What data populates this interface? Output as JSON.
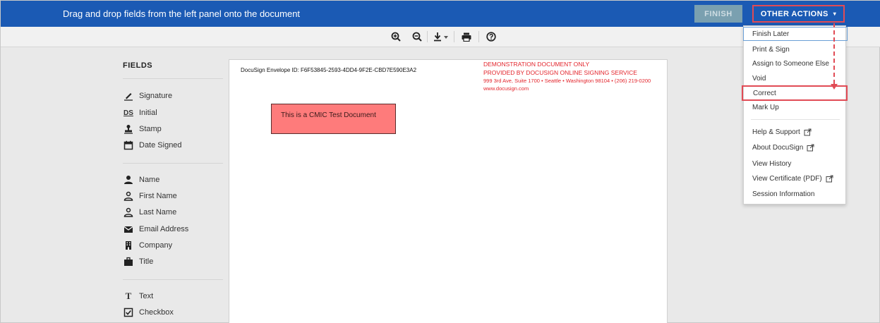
{
  "topbar": {
    "instruction": "Drag and drop fields from the left panel onto the document",
    "finish_label": "FINISH",
    "other_actions_label": "OTHER ACTIONS",
    "other_actions_caret": "▾"
  },
  "toolbar": {
    "icons": [
      "zoom-in-icon",
      "zoom-out-icon",
      "download-icon",
      "print-icon",
      "help-icon"
    ]
  },
  "fields": {
    "title": "FIELDS",
    "group1": [
      {
        "label": "Signature",
        "icon": "signature-icon"
      },
      {
        "label": "Initial",
        "icon": "initial-icon",
        "icon_text": "DS"
      },
      {
        "label": "Stamp",
        "icon": "stamp-icon"
      },
      {
        "label": "Date Signed",
        "icon": "calendar-icon"
      }
    ],
    "group2": [
      {
        "label": "Name",
        "icon": "person-icon"
      },
      {
        "label": "First Name",
        "icon": "person-outline-icon"
      },
      {
        "label": "Last Name",
        "icon": "person-outline-icon"
      },
      {
        "label": "Email Address",
        "icon": "envelope-icon"
      },
      {
        "label": "Company",
        "icon": "building-icon"
      },
      {
        "label": "Title",
        "icon": "briefcase-icon"
      }
    ],
    "group3": [
      {
        "label": "Text",
        "icon": "text-icon",
        "icon_text": "T"
      },
      {
        "label": "Checkbox",
        "icon": "checkbox-icon"
      }
    ]
  },
  "document": {
    "envelope_id": "DocuSign Envelope ID: F6F53845-2593-4DD4-9F2E-CBD7E590E3A2",
    "demo_line1": "DEMONSTRATION DOCUMENT ONLY",
    "demo_line2": "PROVIDED BY DOCUSIGN ONLINE SIGNING SERVICE",
    "demo_line3": "999 3rd Ave, Suite 1700  • Seattle • Washington 98104 • (206) 219-0200",
    "demo_line4": "www.docusign.com",
    "test_text": "This is a CMIC Test Document"
  },
  "menu": {
    "items": [
      {
        "label": "Finish Later",
        "state": "focused"
      },
      {
        "label": "Print & Sign"
      },
      {
        "label": "Assign to Someone Else"
      },
      {
        "label": "Void"
      },
      {
        "label": "Correct",
        "state": "highlighted"
      },
      {
        "label": "Mark Up"
      },
      {
        "label": "Help & Support",
        "external": true
      },
      {
        "label": "About DocuSign",
        "external": true
      },
      {
        "label": "View History"
      },
      {
        "label": "View Certificate (PDF)",
        "external": true
      },
      {
        "label": "Session Information"
      }
    ]
  },
  "colors": {
    "topbar": "#1b5ab4",
    "highlight": "#e14b55",
    "demo_red": "#e3252c",
    "test_box": "#fe7b7b"
  }
}
